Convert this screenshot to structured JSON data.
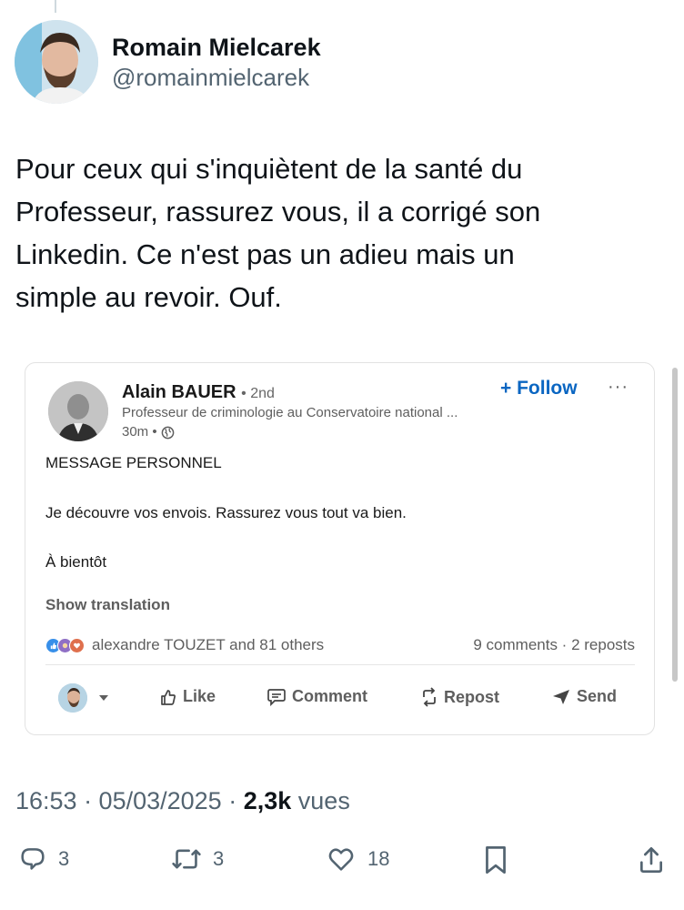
{
  "tweet": {
    "author_name": "Romain Mielcarek",
    "author_handle": "@romainmielcarek",
    "text": "Pour ceux qui s'inquiètent de la santé du\nProfesseur, rassurez vous, il a corrigé son\nLinkedin. Ce n'est pas un adieu mais un\nsimple au revoir. Ouf.",
    "time": "16:53 · 05/03/2025 ·",
    "views_count": "2,3k",
    "views_label": "vues",
    "actions": {
      "replies": "3",
      "reposts": "3",
      "likes": "18"
    }
  },
  "linkedin_post": {
    "author_name": "Alain BAUER",
    "degree": "• 2nd",
    "headline": "Professeur de criminologie au Conservatoire national ...",
    "time": "30m •",
    "follow_label": "+ Follow",
    "more_label": "···",
    "body_lines": [
      "MESSAGE PERSONNEL",
      "Je découvre vos envois. Rassurez vous tout va bien.",
      "À bientôt"
    ],
    "translate_label": "Show translation",
    "reactions_label": "alexandre TOUZET and 81 others",
    "counts_label": "9 comments · 2 reposts",
    "actions": {
      "like": "Like",
      "comment": "Comment",
      "repost": "Repost",
      "send": "Send"
    }
  },
  "colors": {
    "text_primary": "#0f1419",
    "text_secondary": "#536471",
    "linkedin_blue": "#0a66c2",
    "linkedin_gray": "#5e5e5e"
  },
  "icons": [
    "reply-icon",
    "retweet-icon",
    "heart-icon",
    "bookmark-icon",
    "share-icon",
    "globe-icon",
    "thumbs-up-icon",
    "comment-icon",
    "repost-icon",
    "send-icon",
    "caret-down-icon"
  ]
}
